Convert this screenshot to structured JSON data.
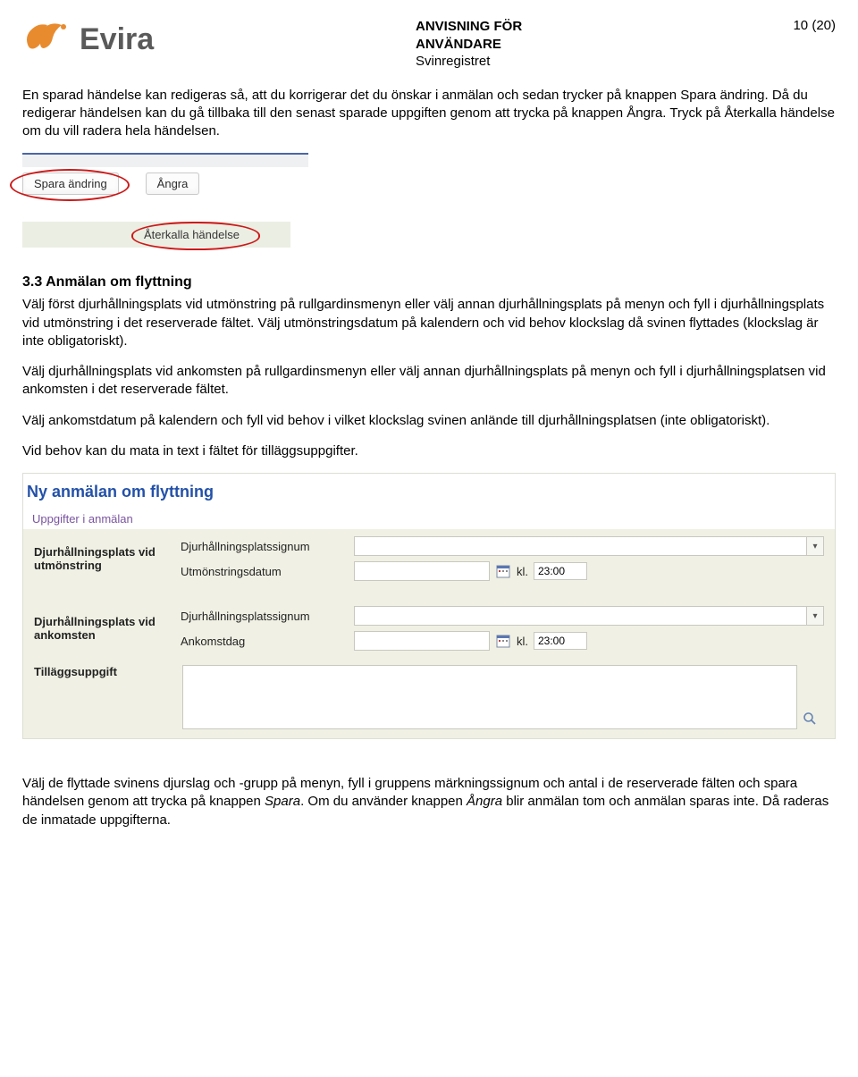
{
  "header": {
    "logo_text": "Evira",
    "title_line1": "ANVISNING FÖR",
    "title_line2": "ANVÄNDARE",
    "title_line3": "Svinregistret",
    "page": "10 (20)"
  },
  "para1": "En sparad händelse kan redigeras så, att du korrigerar det du önskar i anmälan och sedan trycker på knappen Spara ändring. Då du redigerar händelsen kan du gå tillbaka till den senast sparade uppgiften genom att trycka på knappen Ångra. Tryck på Återkalla händelse om du vill radera hela händelsen.",
  "btn_spara": "Spara ändring",
  "btn_angra": "Ångra",
  "btn_recall": "Återkalla händelse",
  "section_heading": "3.3    Anmälan om flyttning",
  "para2": "Välj först djurhållningsplats vid utmönstring på rullgardinsmenyn eller välj annan djurhållningsplats på menyn och fyll i djurhållningsplats vid utmönstring i det reserverade fältet. Välj utmönstringsdatum på kalendern och vid behov klockslag då svinen flyttades (klockslag är inte obligatoriskt).",
  "para3": "Välj djurhållningsplats vid ankomsten på rullgardinsmenyn eller välj annan djurhållningsplats på menyn och fyll i djurhållningsplatsen vid ankomsten i det reserverade fältet.",
  "para4": "Välj ankomstdatum på kalendern och fyll vid behov i vilket klockslag svinen anlände till djurhållningsplatsen (inte obligatoriskt).",
  "para5": "Vid behov kan du mata in text i fältet för tilläggsuppgifter.",
  "form": {
    "title": "Ny anmälan om flyttning",
    "subtitle": "Uppgifter i anmälan",
    "row1_left": "Djurhållningsplats vid utmönstring",
    "row1_mid1": "Djurhållningsplatssignum",
    "row1_mid2": "Utmönstringsdatum",
    "row2_left": "Djurhållningsplats vid ankomsten",
    "row2_mid1": "Djurhållningsplatssignum",
    "row2_mid2": "Ankomstdag",
    "kl": "kl.",
    "time1": "23:00",
    "time2": "23:00",
    "tillagg": "Tilläggsuppgift"
  },
  "para6": "Välj de flyttade svinens djurslag och -grupp på menyn, fyll i gruppens märkningssignum och antal i de reserverade fälten och spara händelsen genom att trycka på knappen Spara. Om du använder knappen Ångra blir anmälan tom och anmälan sparas inte. Då raderas de inmatade uppgifterna."
}
